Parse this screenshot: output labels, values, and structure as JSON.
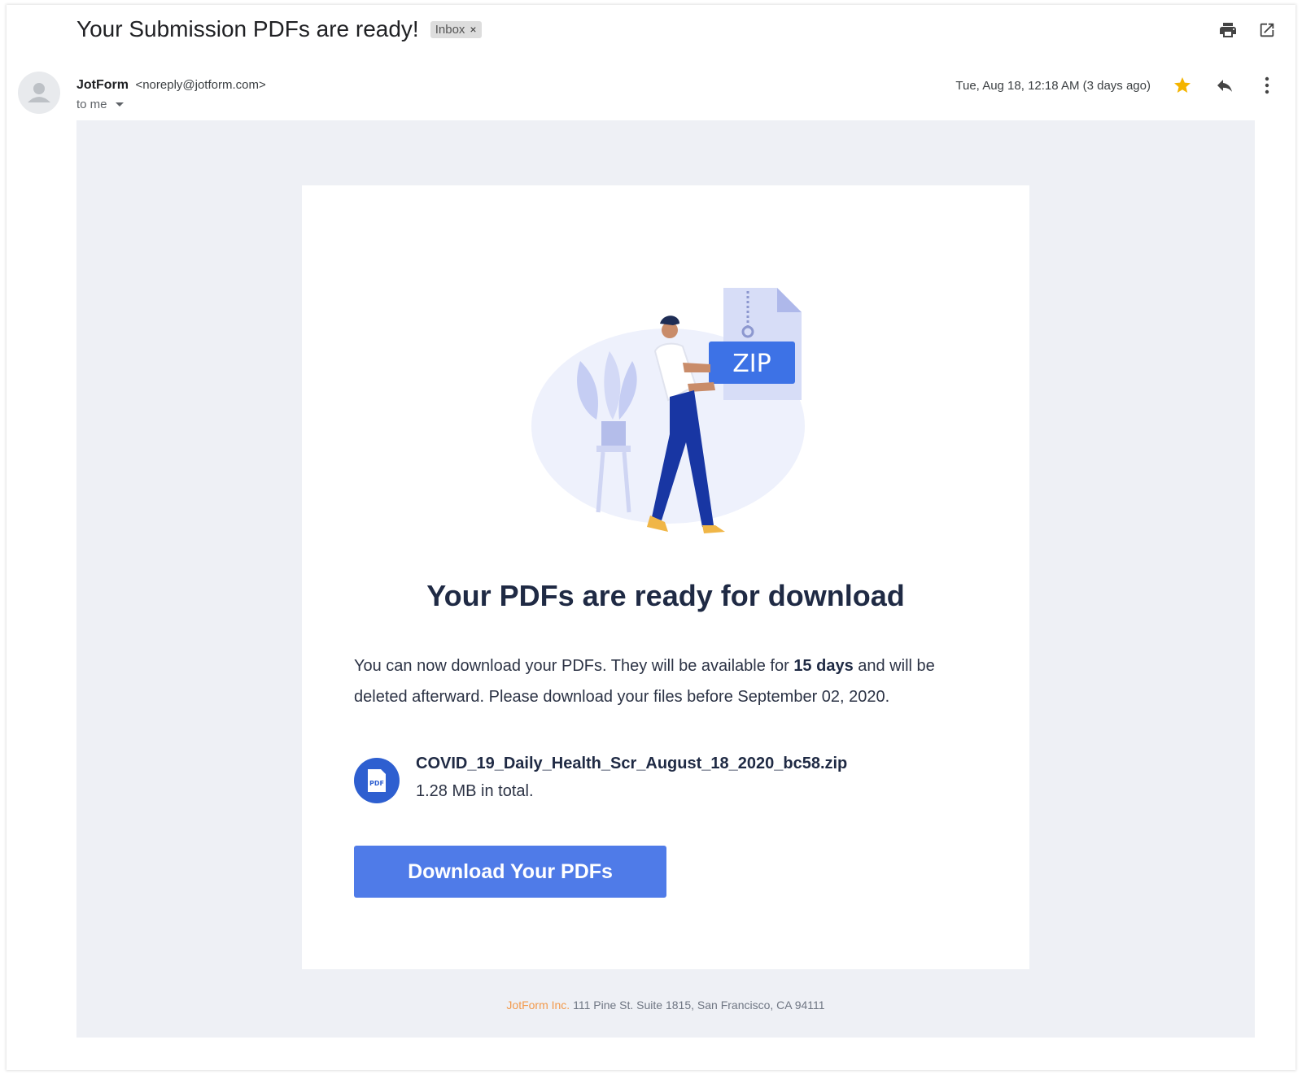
{
  "header": {
    "subject": "Your Submission PDFs are ready!",
    "label": "Inbox",
    "label_close": "×",
    "icons": [
      "print-icon",
      "open-in-new-window-icon"
    ]
  },
  "sender": {
    "name": "JotForm",
    "email": "<noreply@jotform.com>",
    "recipient": "to me",
    "date": "Tue, Aug 18, 12:18 AM (3 days ago)",
    "icons": [
      "star-icon",
      "reply-icon",
      "more-vert-icon"
    ]
  },
  "colors": {
    "accent_button": "#4f7be8",
    "star": "#f4b400",
    "footer_brand": "#f29a4c",
    "email_background": "#eef0f5"
  },
  "email": {
    "illustration_zip_label": "ZIP",
    "headline": "Your PDFs are ready for download",
    "body_part1": "You can now download your PDFs. They will be available for ",
    "body_bold": "15 days",
    "body_part2": " and will be deleted afterward. Please download your files before September 02, 2020.",
    "file_icon_label": "PDF",
    "file_name": "COVID_19_Daily_Health_Scr_August_18_2020_bc58.zip",
    "file_size": "1.28 MB in total.",
    "download_button": "Download Your PDFs"
  },
  "footer": {
    "brand": "JotForm Inc.",
    "address": " 111 Pine St. Suite 1815, San Francisco, CA 94111"
  }
}
